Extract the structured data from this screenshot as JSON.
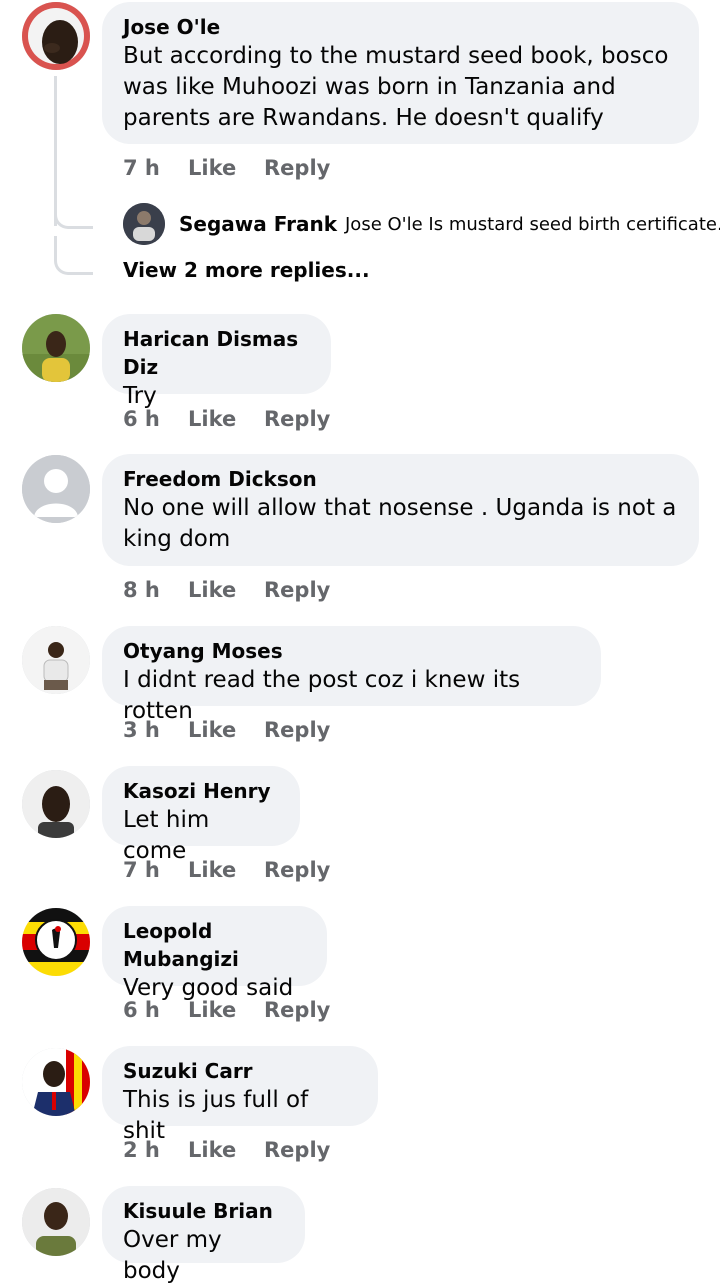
{
  "comments": [
    {
      "author": "Jose O'le",
      "text": "But according to the mustard seed book, bosco was like Muhoozi was born in Tanzania and parents are Rwandans. He doesn't qualify",
      "time": "7 h",
      "like": "Like",
      "reply": "Reply",
      "avatar_icon": "person-photo-icon"
    },
    {
      "author": "Harican Dismas Diz",
      "text": "Try",
      "time": "6 h",
      "like": "Like",
      "reply": "Reply",
      "avatar_icon": "person-photo-icon"
    },
    {
      "author": "Freedom Dickson",
      "text": "No one will allow that nosense . Uganda is not a king dom",
      "time": "8 h",
      "like": "Like",
      "reply": "Reply",
      "avatar_icon": "default-profile-icon"
    },
    {
      "author": "Otyang Moses",
      "text": "I didnt read the post coz i knew its rotten",
      "time": "3 h",
      "like": "Like",
      "reply": "Reply",
      "avatar_icon": "person-photo-icon"
    },
    {
      "author": "Kasozi Henry",
      "text": "Let him come",
      "time": "7 h",
      "like": "Like",
      "reply": "Reply",
      "avatar_icon": "person-photo-icon"
    },
    {
      "author": "Leopold Mubangizi",
      "text": "Very good said",
      "time": "6 h",
      "like": "Like",
      "reply": "Reply",
      "avatar_icon": "uganda-crest-icon"
    },
    {
      "author": "Suzuki Carr",
      "text": "This is jus full of shit",
      "time": "2 h",
      "like": "Like",
      "reply": "Reply",
      "avatar_icon": "person-photo-icon"
    },
    {
      "author": "Kisuule Brian",
      "text": "Over my body",
      "time": "",
      "like": "",
      "reply": "",
      "avatar_icon": "person-photo-icon"
    }
  ],
  "reply_preview": {
    "author": "Segawa Frank",
    "text": "Jose O'le Is mustard seed birth certificate..."
  },
  "view_more": "View 2 more replies...",
  "colors": {
    "bubble": "#f0f2f5",
    "meta": "#65676b",
    "thread": "#dadde1"
  }
}
